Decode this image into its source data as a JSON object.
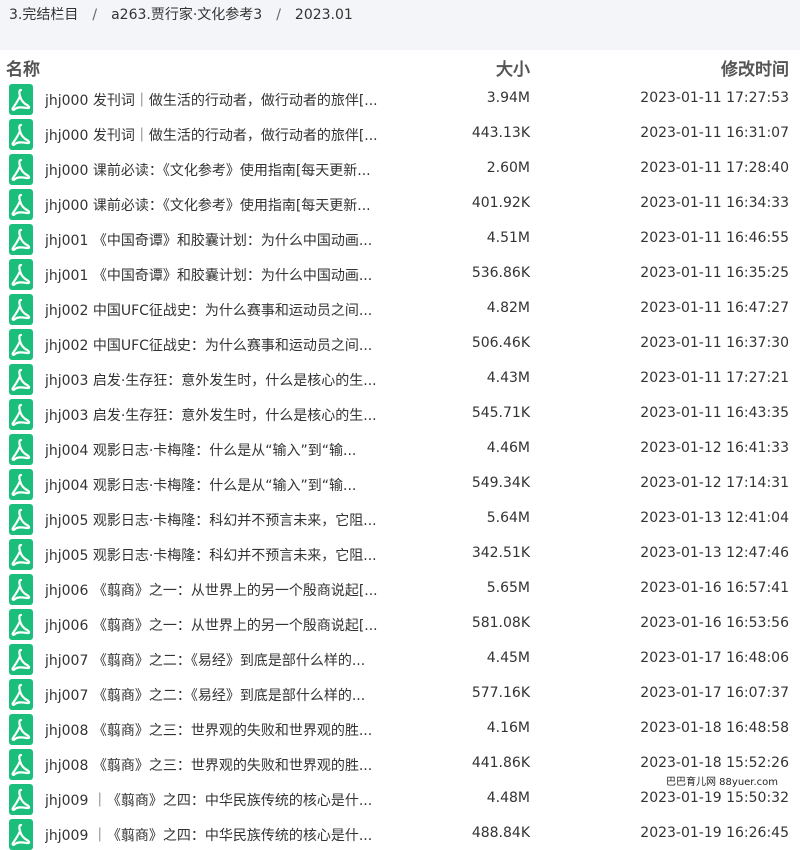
{
  "breadcrumb": [
    "3.完结栏目",
    "a263.贾行家·文化参考3",
    "2023.01"
  ],
  "columns": {
    "name": "名称",
    "size": "大小",
    "modified": "修改时间"
  },
  "icon": "pdf-file-icon",
  "colors": {
    "icon": "#1bbf7b",
    "header_bar": "#f4f5f8"
  },
  "files": [
    {
      "name": "jhj000 发刊词｜做生活的行动者，做行动者的旅伴[...",
      "size": "3.94M",
      "modified": "2023-01-11 17:27:53"
    },
    {
      "name": "jhj000 发刊词｜做生活的行动者，做行动者的旅伴[...",
      "size": "443.13K",
      "modified": "2023-01-11 16:31:07"
    },
    {
      "name": "jhj000 课前必读：《文化参考》使用指南[每天更新...",
      "size": "2.60M",
      "modified": "2023-01-11 17:28:40"
    },
    {
      "name": "jhj000 课前必读：《文化参考》使用指南[每天更新...",
      "size": "401.92K",
      "modified": "2023-01-11 16:34:33"
    },
    {
      "name": "jhj001 《中国奇谭》和胶囊计划：为什么中国动画...",
      "size": "4.51M",
      "modified": "2023-01-11 16:46:55"
    },
    {
      "name": "jhj001 《中国奇谭》和胶囊计划：为什么中国动画...",
      "size": "536.86K",
      "modified": "2023-01-11 16:35:25"
    },
    {
      "name": "jhj002 中国UFC征战史：为什么赛事和运动员之间...",
      "size": "4.82M",
      "modified": "2023-01-11 16:47:27"
    },
    {
      "name": "jhj002 中国UFC征战史：为什么赛事和运动员之间...",
      "size": "506.46K",
      "modified": "2023-01-11 16:37:30"
    },
    {
      "name": "jhj003 启发·生存狂：意外发生时，什么是核心的生...",
      "size": "4.43M",
      "modified": "2023-01-11 17:27:21"
    },
    {
      "name": "jhj003 启发·生存狂：意外发生时，什么是核心的生...",
      "size": "545.71K",
      "modified": "2023-01-11 16:43:35"
    },
    {
      "name": "jhj004 观影日志·卡梅隆：什么是从“输入”到“输...",
      "size": "4.46M",
      "modified": "2023-01-12 16:41:33"
    },
    {
      "name": "jhj004 观影日志·卡梅隆：什么是从“输入”到“输...",
      "size": "549.34K",
      "modified": "2023-01-12 17:14:31"
    },
    {
      "name": "jhj005 观影日志·卡梅隆：科幻并不预言未来，它阻...",
      "size": "5.64M",
      "modified": "2023-01-13 12:41:04"
    },
    {
      "name": "jhj005 观影日志·卡梅隆：科幻并不预言未来，它阻...",
      "size": "342.51K",
      "modified": "2023-01-13 12:47:46"
    },
    {
      "name": "jhj006 《翦商》之一：从世界上的另一个殷商说起[...",
      "size": "5.65M",
      "modified": "2023-01-16 16:57:41"
    },
    {
      "name": "jhj006 《翦商》之一：从世界上的另一个殷商说起[...",
      "size": "581.08K",
      "modified": "2023-01-16 16:53:56"
    },
    {
      "name": "jhj007 《翦商》之二：《易经》到底是部什么样的...",
      "size": "4.45M",
      "modified": "2023-01-17 16:48:06"
    },
    {
      "name": "jhj007 《翦商》之二：《易经》到底是部什么样的...",
      "size": "577.16K",
      "modified": "2023-01-17 16:07:37"
    },
    {
      "name": "jhj008 《翦商》之三：世界观的失败和世界观的胜...",
      "size": "4.16M",
      "modified": "2023-01-18 16:48:58"
    },
    {
      "name": "jhj008 《翦商》之三：世界观的失败和世界观的胜...",
      "size": "441.86K",
      "modified": "2023-01-18 15:52:26"
    },
    {
      "name": "jhj009 ｜《翦商》之四：中华民族传统的核心是什...",
      "size": "4.48M",
      "modified": "2023-01-19 15:50:32"
    },
    {
      "name": "jhj009 ｜《翦商》之四：中华民族传统的核心是什...",
      "size": "488.84K",
      "modified": "2023-01-19 16:26:45"
    }
  ],
  "watermark": "巴巴育儿网 88yuer.com"
}
